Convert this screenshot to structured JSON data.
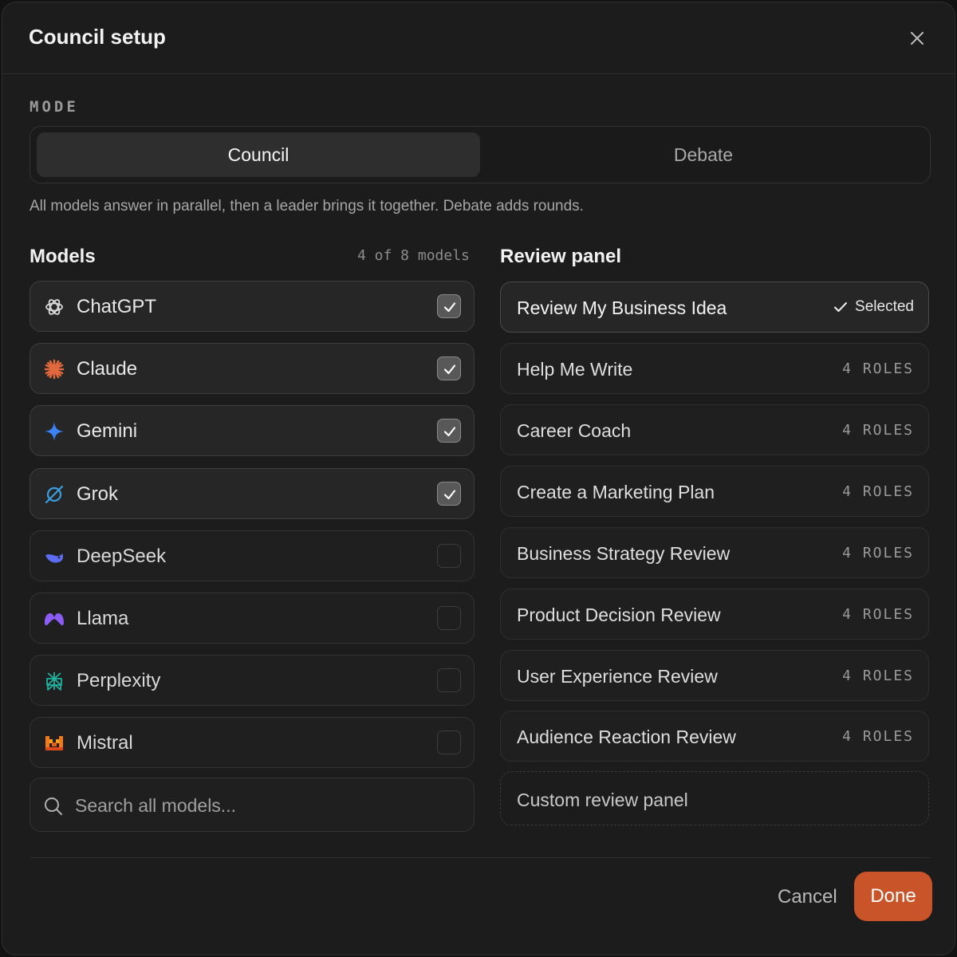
{
  "dialog": {
    "title": "Council setup",
    "close_icon": "close-icon"
  },
  "mode": {
    "label": "MODE",
    "options": [
      "Council",
      "Debate"
    ],
    "selected": "Council",
    "description": "All models answer in parallel, then a leader brings it together. Debate adds rounds."
  },
  "models": {
    "title": "Models",
    "count": "4 of 8 models",
    "items": [
      {
        "name": "ChatGPT",
        "icon": "chatgpt-icon",
        "checked": true
      },
      {
        "name": "Claude",
        "icon": "claude-icon",
        "checked": true
      },
      {
        "name": "Gemini",
        "icon": "gemini-icon",
        "checked": true
      },
      {
        "name": "Grok",
        "icon": "grok-icon",
        "checked": true
      },
      {
        "name": "DeepSeek",
        "icon": "deepseek-icon",
        "checked": false
      },
      {
        "name": "Llama",
        "icon": "llama-icon",
        "checked": false
      },
      {
        "name": "Perplexity",
        "icon": "perplexity-icon",
        "checked": false
      },
      {
        "name": "Mistral",
        "icon": "mistral-icon",
        "checked": false
      }
    ],
    "search_placeholder": "Search all models..."
  },
  "review_panel": {
    "title": "Review panel",
    "items": [
      {
        "name": "Review My Business Idea",
        "badge": "Selected",
        "selected": true
      },
      {
        "name": "Help Me Write",
        "badge": "4 ROLES",
        "selected": false
      },
      {
        "name": "Career Coach",
        "badge": "4 ROLES",
        "selected": false
      },
      {
        "name": "Create a Marketing Plan",
        "badge": "4 ROLES",
        "selected": false
      },
      {
        "name": "Business Strategy Review",
        "badge": "4 ROLES",
        "selected": false
      },
      {
        "name": "Product Decision Review",
        "badge": "4 ROLES",
        "selected": false
      },
      {
        "name": "User Experience Review",
        "badge": "4 ROLES",
        "selected": false
      },
      {
        "name": "Audience Reaction Review",
        "badge": "4 ROLES",
        "selected": false
      }
    ],
    "custom_label": "Custom review panel"
  },
  "footer": {
    "cancel_label": "Cancel",
    "done_label": "Done"
  },
  "colors": {
    "background": "#1c1c1c",
    "accent": "#c9542a",
    "claude": "#e0683c",
    "gemini": "#3b82f6",
    "grok": "#3b9ee0",
    "deepseek": "#5b6cf0",
    "llama": "#8b5cf6",
    "perplexity": "#20b2a0",
    "mistral": "#f07a1a"
  }
}
